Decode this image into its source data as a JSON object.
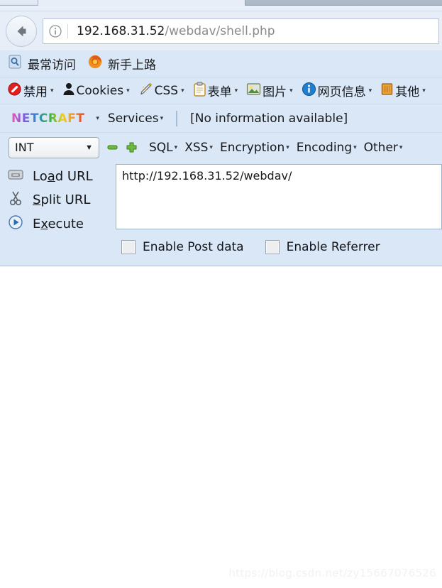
{
  "browser": {
    "back_button": "back-arrow-icon",
    "url": {
      "host": "192.168.31.52",
      "path": "/webdav/shell.php",
      "full": "192.168.31.52/webdav/shell.php",
      "info_icon": "info-circle-icon"
    }
  },
  "bookmarks": {
    "items": [
      {
        "label": "最常访问",
        "icon": "most-visited-icon"
      },
      {
        "label": "新手上路",
        "icon": "firefox-icon"
      }
    ]
  },
  "webdev_toolbar": {
    "items": [
      {
        "label": "禁用",
        "icon": "disable-icon",
        "caret": "▾"
      },
      {
        "label": "Cookies",
        "icon": "cookies-person-icon",
        "caret": "▾"
      },
      {
        "label": "CSS",
        "icon": "css-pencil-icon",
        "caret": "▾"
      },
      {
        "label": "表单",
        "icon": "forms-clipboard-icon",
        "caret": "▾"
      },
      {
        "label": "图片",
        "icon": "images-picture-icon",
        "caret": "▾"
      },
      {
        "label": "网页信息",
        "icon": "page-info-icon",
        "caret": "▾"
      },
      {
        "label": "其他",
        "icon": "other-box-icon",
        "caret": "▾"
      }
    ]
  },
  "netcraft_toolbar": {
    "logo": "NETCRAFT",
    "logo_caret": "▾",
    "services_label": "Services",
    "services_caret": "▾",
    "risk_info": "[No information available]"
  },
  "hackbar": {
    "select": {
      "value": "INT",
      "caret": "▼"
    },
    "minus_icon": "minus-green-icon",
    "plus_icon": "plus-green-icon",
    "menus": [
      {
        "label": "SQL",
        "caret": "▾"
      },
      {
        "label": "XSS",
        "caret": "▾"
      },
      {
        "label": "Encryption",
        "caret": "▾"
      },
      {
        "label": "Encoding",
        "caret": "▾"
      },
      {
        "label": "Other",
        "caret": "▾"
      }
    ],
    "actions": [
      {
        "label": "Load URL",
        "accel": "a",
        "icon": "load-url-icon"
      },
      {
        "label": "Split URL",
        "accel": "S",
        "icon": "scissors-icon"
      },
      {
        "label": "Execute",
        "accel": "x",
        "icon": "execute-play-icon"
      }
    ],
    "url_value": "http://192.168.31.52/webdav/",
    "checkboxes": [
      {
        "label": "Enable Post data",
        "checked": false
      },
      {
        "label": "Enable Referrer",
        "checked": false
      }
    ]
  },
  "page": {
    "body_text": "",
    "watermark": "https://blog.csdn.net/zy15667076526"
  },
  "colors": {
    "toolbar_bg": "#d9e7f7",
    "navbar_bg": "#e7eef8",
    "page_bg": "#ffffff",
    "accent_green": "#57b947",
    "url_host": "#202020",
    "url_path": "#8a8a8a"
  }
}
